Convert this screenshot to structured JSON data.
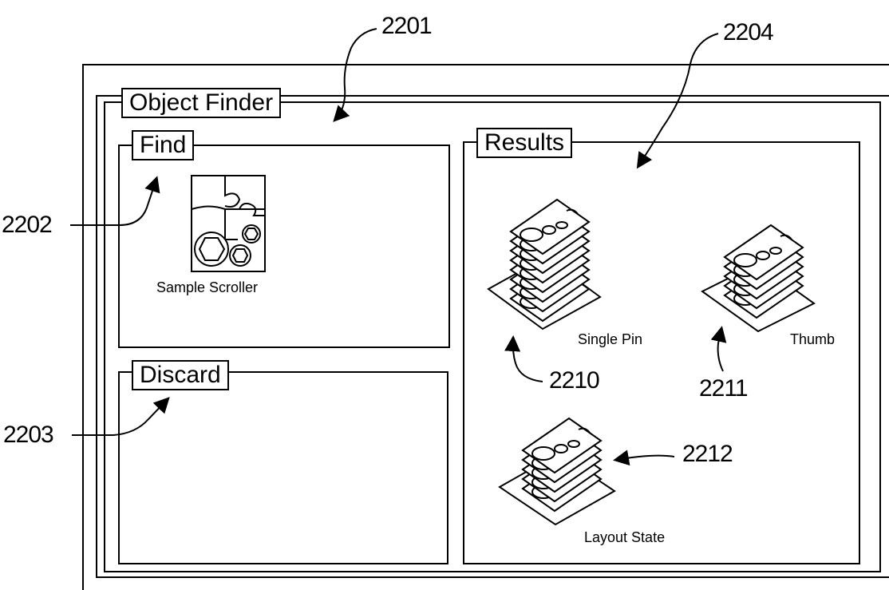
{
  "window": {
    "title": "Object Finder"
  },
  "panels": {
    "find": {
      "title": "Find",
      "item_label": "Sample Scroller",
      "item_icon": "puzzle-gear-icon"
    },
    "discard": {
      "title": "Discard"
    },
    "results": {
      "title": "Results",
      "items": [
        {
          "label": "Single Pin",
          "icon": "stack-pile-icon"
        },
        {
          "label": "Thumb",
          "icon": "stack-pile-icon"
        },
        {
          "label": "Layout State",
          "icon": "stack-pile-icon"
        }
      ]
    }
  },
  "reference_numerals": {
    "window": "2201",
    "find": "2202",
    "discard": "2203",
    "results": "2204",
    "single_pin": "2210",
    "thumb": "2211",
    "layout_state": "2212"
  }
}
